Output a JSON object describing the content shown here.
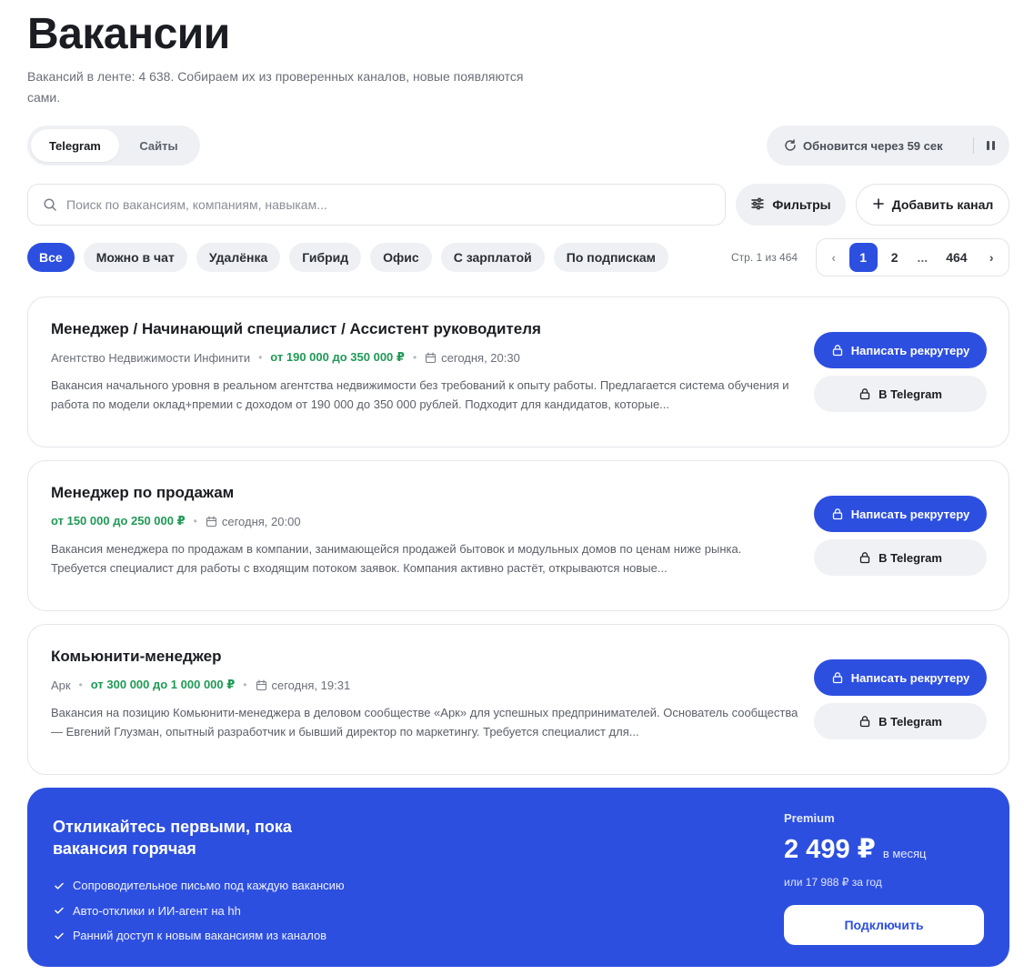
{
  "header": {
    "title": "Вакансии",
    "subtitle": "Вакансий в ленте: 4 638. Собираем их из проверенных каналов, новые появляются сами."
  },
  "source_tabs": [
    {
      "label": "Telegram",
      "active": true
    },
    {
      "label": "Сайты",
      "active": false
    }
  ],
  "refresh": {
    "text": "Обновится через 59 сек"
  },
  "search": {
    "placeholder": "Поиск по вакансиям, компаниям, навыкам..."
  },
  "toolbar": {
    "filters_label": "Фильтры",
    "add_channel_label": "Добавить канал"
  },
  "chips": [
    {
      "label": "Все",
      "active": true
    },
    {
      "label": "Можно в чат",
      "active": false
    },
    {
      "label": "Удалёнка",
      "active": false
    },
    {
      "label": "Гибрид",
      "active": false
    },
    {
      "label": "Офис",
      "active": false
    },
    {
      "label": "С зарплатой",
      "active": false
    },
    {
      "label": "По подпискам",
      "active": false
    }
  ],
  "pagination": {
    "info": "Стр. 1 из 464",
    "current": "1",
    "next": "2",
    "dots": "...",
    "last": "464"
  },
  "jobs": [
    {
      "title": "Менеджер / Начинающий специалист / Ассистент руководителя",
      "company": "Агентство Недвижимости Инфинити",
      "salary": "от 190 000 до 350 000 ₽",
      "date": "сегодня, 20:30",
      "description": "Вакансия начального уровня в реальном агентства недвижимости без требований к опыту работы. Предлагается система обучения и работа по модели оклад+премии с доходом от 190 000 до 350 000 рублей. Подходит для кандидатов, которые...",
      "primary_label": "Написать рекрутеру",
      "telegram_label": "В Telegram"
    },
    {
      "title": "Менеджер по продажам",
      "company": "",
      "salary": "от 150 000 до 250 000 ₽",
      "date": "сегодня, 20:00",
      "description": "Вакансия менеджера по продажам в компании, занимающейся продажей бытовок и модульных домов по ценам ниже рынка. Требуется специалист для работы с входящим потоком заявок. Компания активно растёт, открываются новые...",
      "primary_label": "Написать рекрутеру",
      "telegram_label": "В Telegram"
    },
    {
      "title": "Комьюнити-менеджер",
      "company": "Арк",
      "salary": "от 300 000 до 1 000 000 ₽",
      "date": "сегодня, 19:31",
      "description": "Вакансия на позицию Комьюнити-менеджера в деловом сообществе «Арк» для успешных предпринимателей. Основатель сообщества — Евгений Глузман, опытный разработчик и бывший директор по маркетингу. Требуется специалист для...",
      "primary_label": "Написать рекрутеру",
      "telegram_label": "В Telegram"
    }
  ],
  "promo": {
    "headline": "Откликайтесь первыми, пока вакансия горячая",
    "features": [
      "Сопроводительное письмо под каждую вакансию",
      "Авто-отклики и ИИ-агент на hh",
      "Ранний доступ к новым вакансиям из каналов"
    ],
    "tier": "Premium",
    "price": "2 499 ₽",
    "period": "в месяц",
    "yearly": "или 17 988 ₽ за год",
    "cta": "Подключить"
  },
  "colors": {
    "accent": "#2d4fe0",
    "salary": "#1f9a55",
    "soft_bg": "#eef0f3"
  }
}
